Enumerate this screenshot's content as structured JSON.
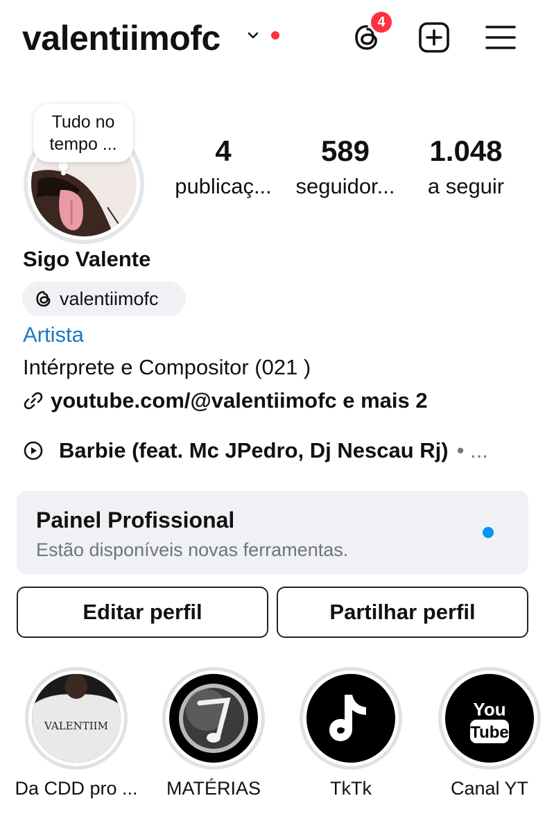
{
  "header": {
    "username": "valentiimofc",
    "threads_badge_count": "4",
    "colors": {
      "notification": "#ff3040"
    },
    "icons": [
      "chevron-down-icon",
      "threads-icon",
      "create-post-icon",
      "menu-icon"
    ]
  },
  "profile": {
    "note": "Tudo no tempo ...",
    "stats": [
      {
        "value": "4",
        "label": "publicaç..."
      },
      {
        "value": "589",
        "label": "seguidor..."
      },
      {
        "value": "1.048",
        "label": "a seguir"
      }
    ],
    "display_name": "Sigo Valente",
    "threads_handle": "valentiimofc",
    "category": "Artista",
    "category_color": "#1f77c2",
    "bio": "Intérprete e Compositor (021 )",
    "link": "youtube.com/@valentiimofc e mais 2",
    "music": "Barbie (feat. Mc JPedro, Dj Nescau Rj)",
    "music_more": "• ..."
  },
  "dashboard": {
    "title": "Painel Profissional",
    "subtitle": "Estão disponíveis novas ferramentas.",
    "dot_color": "#0095f6"
  },
  "actions": {
    "edit_label": "Editar perfil",
    "share_label": "Partilhar perfil"
  },
  "highlights": [
    {
      "label": "Da CDD pro ...",
      "shirt_text": "VALENTIIM"
    },
    {
      "label": "MATÉRIAS"
    },
    {
      "label": "TkTk"
    },
    {
      "label": "Canal YT",
      "logo_top": "You",
      "logo_bottom": "Tube"
    }
  ]
}
